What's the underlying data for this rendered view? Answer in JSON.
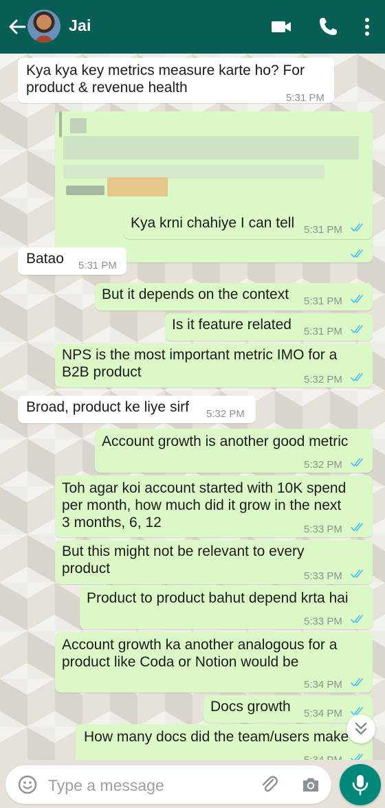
{
  "header": {
    "contact_name": "Jai",
    "color": "#075e54",
    "icons": [
      "back-arrow-icon",
      "avatar",
      "video-call-icon",
      "voice-call-icon",
      "more-options-icon"
    ]
  },
  "messages": [
    {
      "direction": "incoming",
      "text": "Kya kya key metrics measure karte ho? For\nproduct & revenue health",
      "time": "5:31 PM"
    },
    {
      "direction": "outgoing",
      "text": "",
      "time": "",
      "blurred": true,
      "read": true
    },
    {
      "direction": "outgoing",
      "text": "Kya krni chahiye I can tell",
      "time": "5:31 PM",
      "read": true
    },
    {
      "direction": "incoming",
      "text": "Batao",
      "time": "5:31 PM"
    },
    {
      "direction": "outgoing",
      "text": "But it depends on the context",
      "time": "5:31 PM",
      "read": true
    },
    {
      "direction": "outgoing",
      "text": "Is it feature related",
      "time": "5:31 PM",
      "read": true
    },
    {
      "direction": "outgoing",
      "text": "NPS is the most important metric IMO for a\nB2B product",
      "time": "5:32 PM",
      "read": true
    },
    {
      "direction": "incoming",
      "text": "Broad, product ke liye sirf",
      "time": "5:32 PM"
    },
    {
      "direction": "outgoing",
      "text": "Account growth is another good metric",
      "time": "5:32 PM",
      "read": true
    },
    {
      "direction": "outgoing",
      "text": "Toh agar koi account started with 10K spend\nper month, how much did it grow in the next\n3 months, 6, 12",
      "time": "5:33 PM",
      "read": true
    },
    {
      "direction": "outgoing",
      "text": "But this might not be relevant to every\nproduct",
      "time": "5:33 PM",
      "read": true
    },
    {
      "direction": "outgoing",
      "text": "Product to product bahut depend krta hai",
      "time": "5:33 PM",
      "read": true
    },
    {
      "direction": "outgoing",
      "text": "Account growth ka another analogous for a\nproduct like Coda or Notion would be",
      "time": "5:34 PM",
      "read": true
    },
    {
      "direction": "outgoing",
      "text": "Docs growth",
      "time": "5:34 PM",
      "read": true
    },
    {
      "direction": "outgoing",
      "text": "How many docs did the team/users make",
      "time": "5:34 PM",
      "read": true
    }
  ],
  "colors": {
    "incoming_bubble": "#ffffff",
    "outgoing_bubble": "#dcf8c6",
    "read_ticks": "#4fc3f7",
    "mic_button": "#00897b"
  },
  "composer": {
    "placeholder": "Type a message",
    "icons": [
      "emoji-icon",
      "attach-icon",
      "camera-icon",
      "mic-icon"
    ]
  },
  "scroll_button_icon": "double-chevron-down-icon"
}
